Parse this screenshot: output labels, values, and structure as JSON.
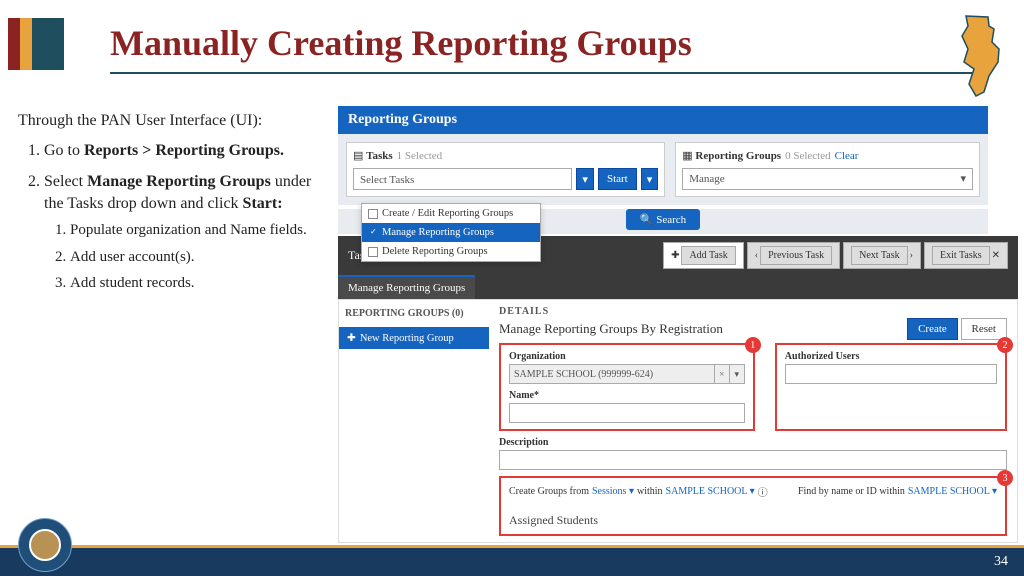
{
  "title": "Manually Creating Reporting Groups",
  "intro": "Through the PAN User Interface (UI):",
  "steps": {
    "s1_prefix": "Go to ",
    "s1_bold": "Reports > Reporting Groups.",
    "s2_prefix": "Select ",
    "s2_bold": "Manage Reporting Groups",
    "s2_mid": " under the Tasks drop down and click ",
    "s2_bold2": "Start:",
    "sub1": "Populate organization and Name fields.",
    "sub2": "Add user account(s).",
    "sub3": "Add student records."
  },
  "shot1": {
    "header": "Reporting Groups",
    "tasks_label": "Tasks",
    "tasks_selected": "1 Selected",
    "select_tasks": "Select Tasks",
    "start": "Start",
    "opt1": "Create / Edit Reporting Groups",
    "opt2": "Manage Reporting Groups",
    "opt3": "Delete Reporting Groups",
    "search": "Search",
    "rg_label": "Reporting Groups",
    "rg_selected": "0 Selected",
    "clear": "Clear",
    "manage": "Manage"
  },
  "shot2": {
    "title": "Tasks for Reporting Groups",
    "add_task": "Add Task",
    "prev": "Previous Task",
    "next": "Next Task",
    "exit": "Exit Tasks",
    "tab": "Manage Reporting Groups",
    "rg_hd": "REPORTING GROUPS (0)",
    "new_rg": "New Reporting Group",
    "details": "DETAILS",
    "details_title": "Manage Reporting Groups By Registration",
    "create": "Create",
    "reset": "Reset",
    "org_label": "Organization",
    "org_value": "SAMPLE SCHOOL (999999-624)",
    "name_label": "Name*",
    "auth_label": "Authorized Users",
    "desc_label": "Description",
    "cg_from": "Create Groups from",
    "sessions": "Sessions",
    "within": "within",
    "school": "SAMPLE SCHOOL",
    "find": "Find by name or ID within",
    "assigned": "Assigned Students",
    "badge1": "1",
    "badge2": "2",
    "badge3": "3"
  },
  "footer": {
    "page": "34"
  }
}
